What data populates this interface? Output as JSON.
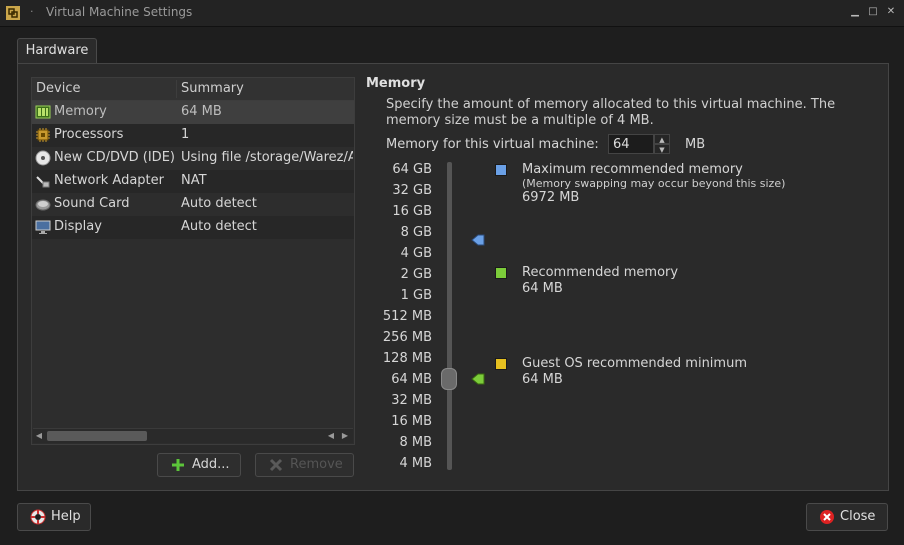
{
  "window": {
    "title": "Virtual Machine Settings",
    "title_dot": "·",
    "controls": {
      "minimize": "▁",
      "maximize": "□",
      "close": "✕"
    }
  },
  "tabs": [
    {
      "label": "Hardware"
    }
  ],
  "device_list": {
    "columns": [
      "Device",
      "Summary"
    ],
    "rows": [
      {
        "icon": "memory-icon",
        "device": "Memory",
        "summary": "64 MB",
        "selected": true
      },
      {
        "icon": "processor-icon",
        "device": "Processors",
        "summary": "1"
      },
      {
        "icon": "cd-dvd-icon",
        "device": "New CD/DVD (IDE)",
        "summary": "Using file /storage/Warez/A"
      },
      {
        "icon": "network-icon",
        "device": "Network Adapter",
        "summary": "NAT"
      },
      {
        "icon": "sound-icon",
        "device": "Sound Card",
        "summary": "Auto detect"
      },
      {
        "icon": "display-icon",
        "device": "Display",
        "summary": "Auto detect"
      }
    ],
    "scroll_left": "◀",
    "scroll_right": "▶"
  },
  "buttons": {
    "add": "Add...",
    "remove": "Remove",
    "help": "Help",
    "close": "Close"
  },
  "memory": {
    "title": "Memory",
    "description": "Specify the amount of memory allocated to this virtual machine. The memory size must be a multiple of 4 MB.",
    "field_label": "Memory for this virtual machine:",
    "value": "64",
    "unit": "MB",
    "spin_up": "▲",
    "spin_down": "▼",
    "scale": [
      "64 GB",
      "32 GB",
      "16 GB",
      "8 GB",
      "4 GB",
      "2 GB",
      "1 GB",
      "512 MB",
      "256 MB",
      "128 MB",
      "64 MB",
      "32 MB",
      "16 MB",
      "8 MB",
      "4 MB"
    ],
    "legend": [
      {
        "color": "#6aa0e6",
        "title": "Maximum recommended memory",
        "note": "(Memory swapping may occur beyond this size)",
        "value": "6972 MB"
      },
      {
        "color": "#7ccc3a",
        "title": "Recommended memory",
        "value": "64 MB"
      },
      {
        "color": "#e6c020",
        "title": "Guest OS recommended minimum",
        "value": "64 MB"
      }
    ]
  }
}
